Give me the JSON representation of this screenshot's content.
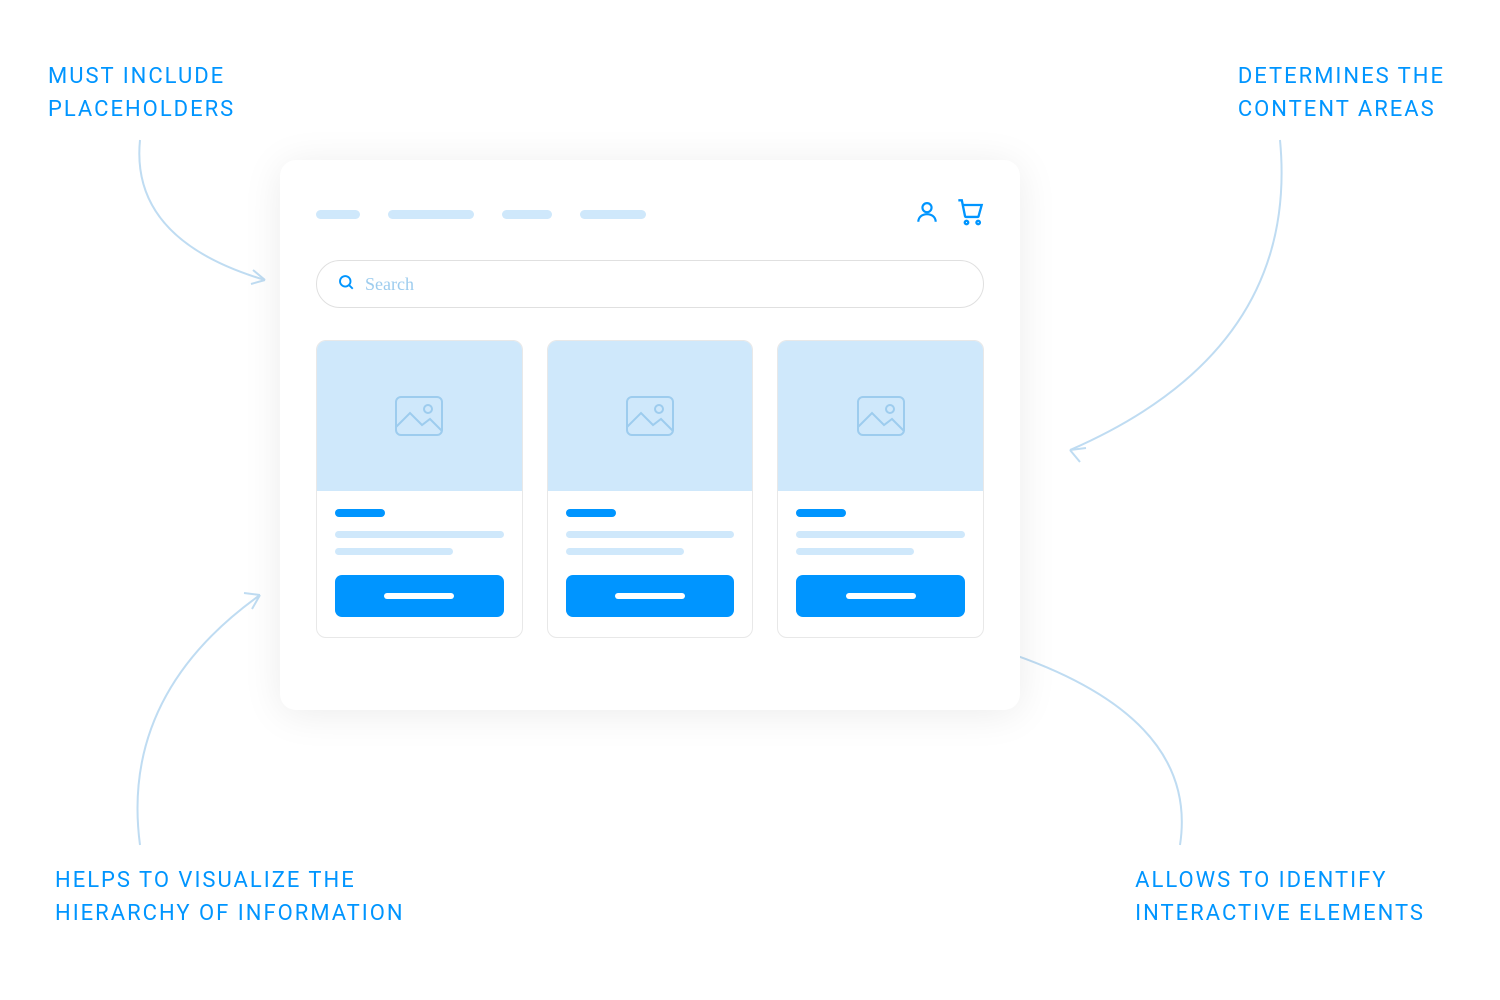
{
  "annotations": {
    "top_left": "MUST INCLUDE\nPLACEHOLDERS",
    "top_right": "DETERMINES THE\nCONTENT AREAS",
    "bottom_left": "HELPS TO VISUALIZE THE\nHIERARCHY OF INFORMATION",
    "bottom_right": "ALLOWS TO IDENTIFY\nINTERACTIVE ELEMENTS"
  },
  "wireframe": {
    "search_placeholder": "Search"
  },
  "colors": {
    "primary": "#0095FF",
    "light_blue": "#CFE8FB",
    "stroke_light": "#BFDCF2"
  }
}
